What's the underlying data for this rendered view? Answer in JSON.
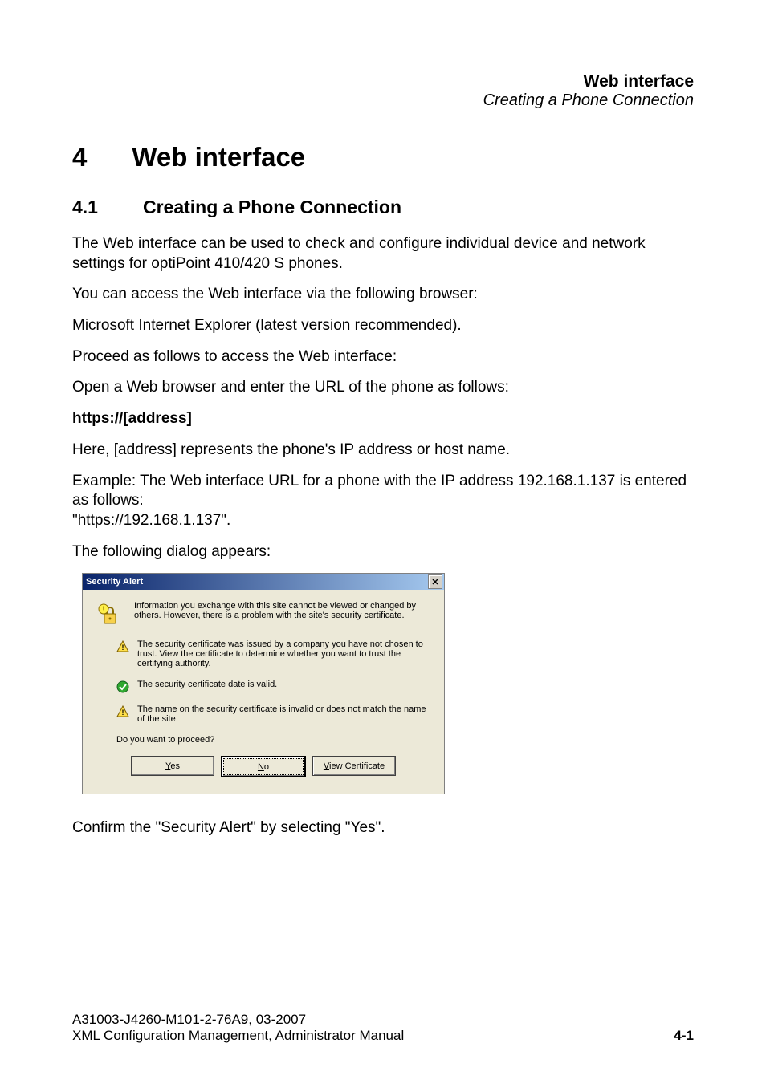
{
  "header": {
    "title": "Web interface",
    "subtitle": "Creating a Phone Connection"
  },
  "h1_num": "4",
  "h1_text": "Web interface",
  "h2_num": "4.1",
  "h2_text": "Creating a Phone Connection",
  "p_intro": "The Web interface can be used to check and configure individual device and network settings for optiPoint 410/420 S phones.",
  "p_access": "You can access the Web interface via the following browser:",
  "p_browser": "Microsoft Internet Explorer (latest version recommended).",
  "p_proceed": "Proceed as follows to access the Web interface:",
  "p_open": "Open a Web browser and enter the URL of the phone as follows:",
  "p_url": "https://[address]",
  "p_here": "Here, [address] represents the phone's IP address or host name.",
  "p_example": "Example: The Web interface URL for a phone with the IP address 192.168.1.137 is entered as follows:\n\"https://192.168.1.137\".",
  "p_dialog": "The following dialog appears:",
  "p_confirm": "Confirm the \"Security Alert\" by selecting \"Yes\".",
  "dialog": {
    "title": "Security Alert",
    "main_text": "Information you exchange with this site cannot be viewed or changed by others. However, there is a problem with the site's security certificate.",
    "items": [
      {
        "status": "warn",
        "text": "The security certificate was issued by a company you have not chosen to trust. View the certificate to determine whether you want to trust the certifying authority."
      },
      {
        "status": "ok",
        "text": "The security certificate date is valid."
      },
      {
        "status": "warn",
        "text": "The name on the security certificate is invalid or does not match the name of the site"
      }
    ],
    "prompt": "Do you want to proceed?",
    "btn_yes_u": "Y",
    "btn_yes_rest": "es",
    "btn_no_u": "N",
    "btn_no_rest": "o",
    "btn_view_u": "V",
    "btn_view_rest": "iew Certificate"
  },
  "footer": {
    "line1": "A31003-J4260-M101-2-76A9, 03-2007",
    "line2": "XML Configuration Management, Administrator Manual",
    "page": "4-1"
  }
}
